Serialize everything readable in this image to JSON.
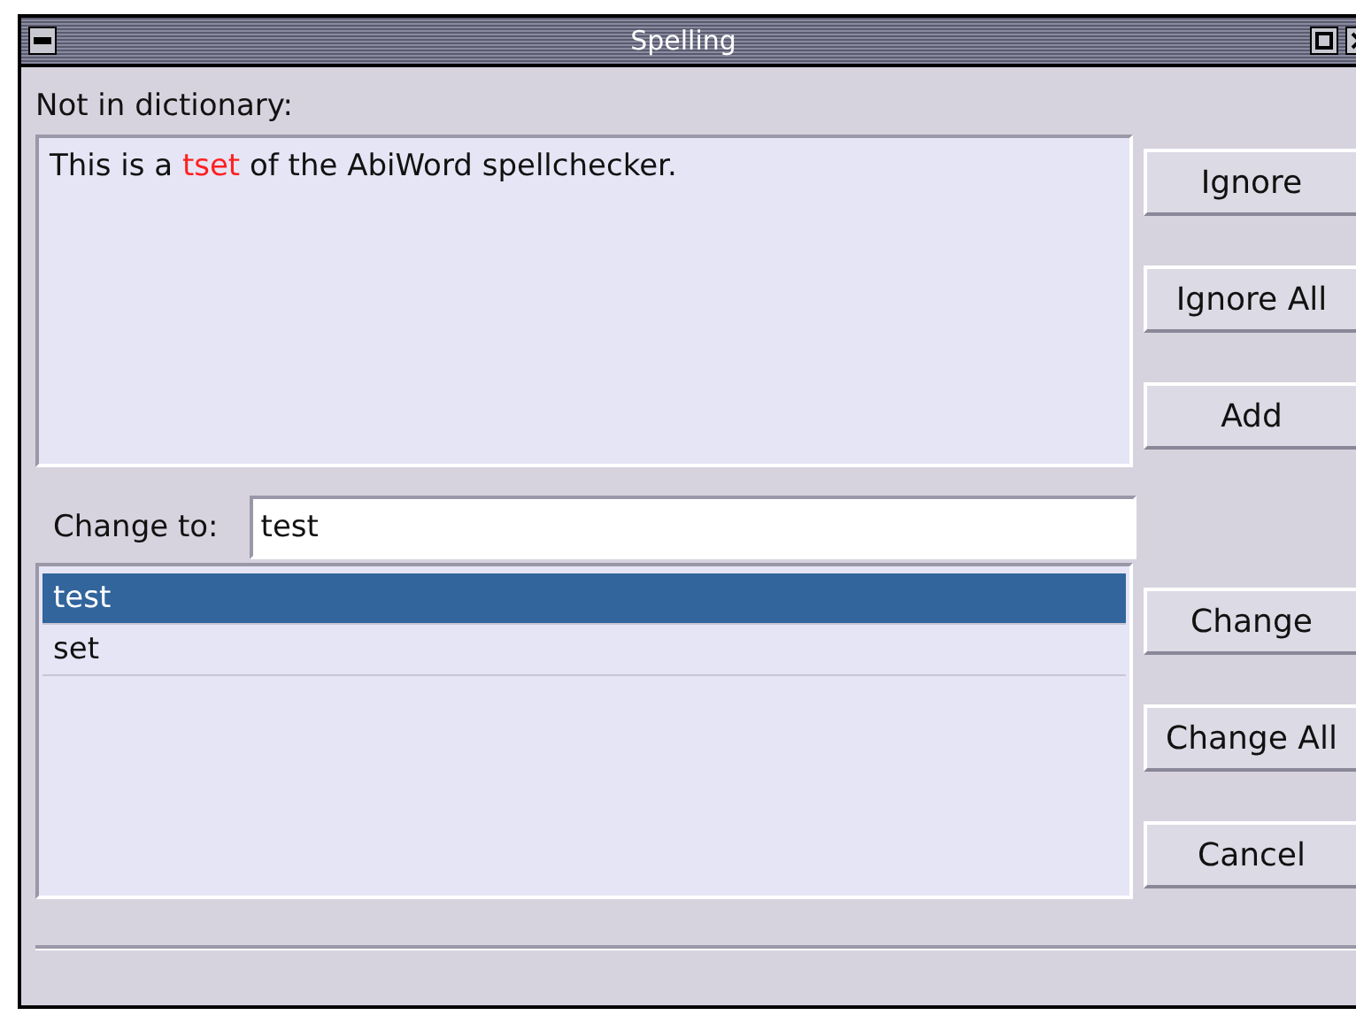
{
  "window": {
    "title": "Spelling"
  },
  "not_in_dictionary": {
    "label": "Not in dictionary:",
    "sentence": [
      {
        "text": "This is a ",
        "flagged": false
      },
      {
        "text": "tset",
        "flagged": true
      },
      {
        "text": " of the AbiWord spellchecker.",
        "flagged": false
      }
    ]
  },
  "top_buttons": [
    "Ignore",
    "Ignore All",
    "Add"
  ],
  "change_to": {
    "label": "Change to:",
    "value": "test"
  },
  "suggestions": [
    {
      "text": "test",
      "selected": true
    },
    {
      "text": "set",
      "selected": false
    }
  ],
  "bottom_buttons": [
    "Change",
    "Change All",
    "Cancel"
  ]
}
